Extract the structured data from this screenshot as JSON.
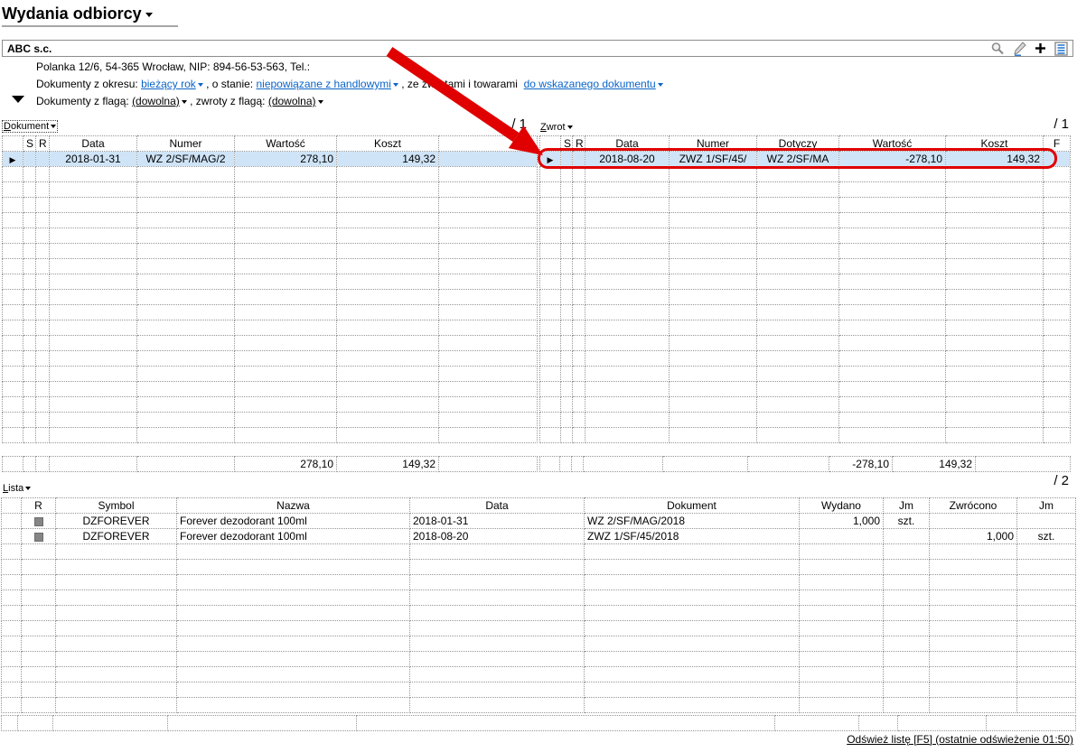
{
  "page": {
    "title": "Wydania odbiorcy"
  },
  "header": {
    "company": "ABC s.c.",
    "address": "Polanka 12/6, 54-365 Wrocław, NIP: 894-56-53-563, Tel.:",
    "icons": [
      "search",
      "edit",
      "add",
      "notes"
    ]
  },
  "filters": {
    "period_label": "Dokumenty z okresu:",
    "period_value": "bieżący rok",
    "state_label": ", o stanie:",
    "state_value": "niepowiązane z handlowymi",
    "returns_label": ", ze zwrotami i towarami",
    "target_value": "do wskazanego dokumentu",
    "flag_label": "Dokumenty z flagą:",
    "flag_value": "(dowolna)",
    "return_flag_label": ", zwroty z flagą:",
    "return_flag_value": "(dowolna)"
  },
  "left_table": {
    "label": "Dokument",
    "page_indicator": "/ 1",
    "columns": [
      "",
      "S",
      "R",
      "Data",
      "Numer",
      "Wartość",
      "Koszt",
      ""
    ],
    "rows": [
      [
        "▶",
        "",
        "",
        "2018-01-31",
        "WZ 2/SF/MAG/2",
        "278,10",
        "149,32",
        ""
      ]
    ],
    "selected_row": 0,
    "totals": {
      "wartosc": "278,10",
      "koszt": "149,32"
    }
  },
  "right_table": {
    "label": "Zwrot",
    "page_indicator": "/ 1",
    "columns": [
      "",
      "S",
      "R",
      "Data",
      "Numer",
      "Dotyczy",
      "Wartość",
      "Koszt",
      "F"
    ],
    "rows": [
      [
        "▶",
        "",
        "",
        "2018-08-20",
        "ZWZ 1/SF/45/",
        "WZ 2/SF/MA",
        "-278,10",
        "149,32",
        ""
      ]
    ],
    "selected_row": 0,
    "totals": {
      "wartosc": "-278,10",
      "koszt": "149,32"
    }
  },
  "bottom_table": {
    "label": "Lista",
    "page_indicator": "/ 2",
    "columns": [
      "",
      "R",
      "Symbol",
      "Nazwa",
      "Data",
      "Dokument",
      "Wydano",
      "Jm",
      "Zwrócono",
      "Jm"
    ],
    "rows": [
      [
        "",
        "■",
        "DZFOREVER",
        "Forever dezodorant 100ml",
        "2018-01-31",
        "WZ 2/SF/MAG/2018",
        "1,000",
        "szt.",
        "",
        ""
      ],
      [
        "",
        "■",
        "DZFOREVER",
        "Forever dezodorant 100ml",
        "2018-08-20",
        "ZWZ 1/SF/45/2018",
        "",
        "",
        "1,000",
        "szt."
      ]
    ]
  },
  "status_bar": {
    "refresh_link": "Odśwież listę [F5] (ostatnie odświeżenie 01:50)"
  },
  "annotation": {
    "type": "red-arrow-and-highlight",
    "color": "#e00000"
  },
  "colors": {
    "accent_red": "#e00000",
    "selection_blue": "#cfe4f7",
    "link_blue": "#0a64c8"
  }
}
